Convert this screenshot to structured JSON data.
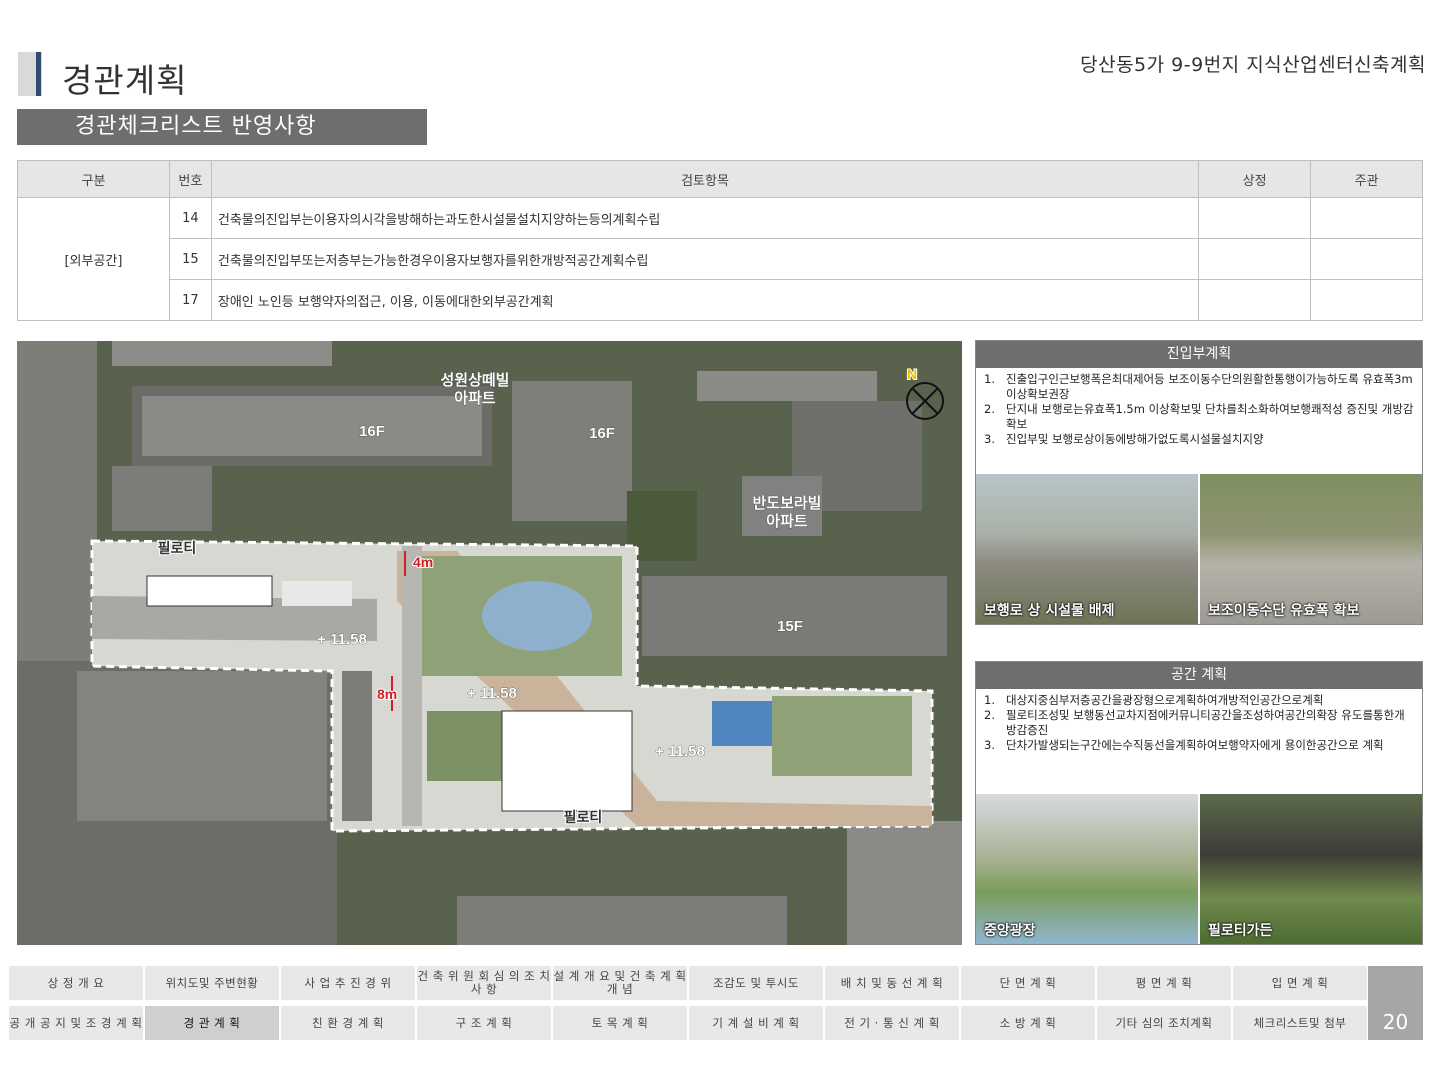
{
  "header": {
    "title": "경관계획",
    "project": "당산동5가 9-9번지 지식산업센터신축계획"
  },
  "section": {
    "label": "경관체크리스트 반영사항"
  },
  "checklist": {
    "columns": [
      "구분",
      "번호",
      "검토항목",
      "상정",
      "주관"
    ],
    "category": "[외부공간]",
    "rows": [
      {
        "no": "14",
        "item": "건축물의진입부는이용자의시각을방해하는과도한시설물설치지양하는등의계획수립",
        "a": "",
        "b": ""
      },
      {
        "no": "15",
        "item": "건축물의진입부또는저층부는가능한경우이용자보행자를위한개방적공간계획수립",
        "a": "",
        "b": ""
      },
      {
        "no": "17",
        "item": "장애인 노인등 보행약자의접근, 이용, 이동에대한외부공간계획",
        "a": "",
        "b": ""
      }
    ]
  },
  "siteplan": {
    "labels": {
      "apt1": "성원상떼빌",
      "apt1b": "아파트",
      "apt2": "반도보라빌",
      "apt2b": "아파트",
      "f16a": "16F",
      "f16b": "16F",
      "f15": "15F",
      "piloti1": "필로티",
      "piloti2": "필로티",
      "lvl1": "+ 11.58",
      "lvl2": "+ 11.58",
      "lvl3": "+ 11.58",
      "dim1": "4m",
      "dim2": "8m",
      "north": "N"
    }
  },
  "panel_entry": {
    "title": "진입부계획",
    "items": [
      {
        "n": "1.",
        "text": "진출입구인근보행폭은최대제어등 보조이동수단의원활한통행이가능하도록 유효폭3m 이상확보권장"
      },
      {
        "n": "2.",
        "text": "단지내 보행로는유효폭1.5m 이상확보및 단차를최소화하여보행쾌적성 증진및 개방감확보"
      },
      {
        "n": "3.",
        "text": "진입부및 보행로상이동에방해가없도록시설물설치지양"
      }
    ],
    "photos": [
      "보행로 상 시설물 배제",
      "보조이동수단 유효폭 확보"
    ]
  },
  "panel_space": {
    "title": "공간 계획",
    "items": [
      {
        "n": "1.",
        "text": "대상지중심부저층공간을광장형으로계획하여개방적인공간으로계획"
      },
      {
        "n": "2.",
        "text": "필로티조성및 보행동선교차지점에커뮤니티공간을조성하여공간의확장 유도를통한개방감증진"
      },
      {
        "n": "3.",
        "text": "단차가발생되는구간에는수직동선을계획하여보행약자에게 용이한공간으로 계획"
      }
    ],
    "photos": [
      "중앙광장",
      "필로티가든"
    ]
  },
  "nav": {
    "row1": [
      "상 정 개 요",
      "위치도및 주변현황",
      "사 업 추 진 경 위",
      "건 축 위 원 회 심 의 조 치 사 항",
      "설 계 개 요 및 건 축 계 획 개 념",
      "조감도 및 투시도",
      "배 치 및 동 선 계 획",
      "단 면 계 획",
      "평 면 계 획",
      "입 면 계 획"
    ],
    "row2": [
      "공 개 공 지 및 조 경 계 획",
      "경 관 계 획",
      "친 환 경 계 획",
      "구 조 계 획",
      "토 목 계 획",
      "기 계 설 비 계 획",
      "전 기 · 통 신 계 획",
      "소 방 계 획",
      "기타 심의 조치계획",
      "체크리스트및 첨부"
    ],
    "active": "경 관 계 획"
  },
  "page_number": "20",
  "colors": {
    "band": "#6e6e6e",
    "accent": "#2f4a72",
    "dimension": "#d0202a"
  }
}
